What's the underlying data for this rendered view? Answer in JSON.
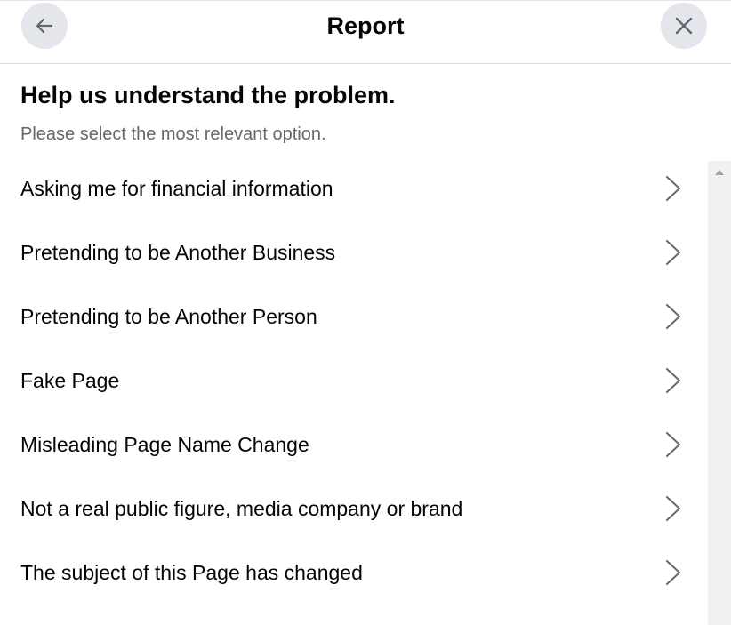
{
  "header": {
    "title": "Report",
    "back_icon": "arrow-left-icon",
    "close_icon": "close-icon"
  },
  "main": {
    "heading": "Help us understand the problem.",
    "subheading": "Please select the most relevant option.",
    "options": [
      {
        "label": "Asking me for financial information",
        "icon": "chevron-right-icon"
      },
      {
        "label": "Pretending to be Another Business",
        "icon": "chevron-right-icon"
      },
      {
        "label": "Pretending to be Another Person",
        "icon": "chevron-right-icon"
      },
      {
        "label": "Fake Page",
        "icon": "chevron-right-icon"
      },
      {
        "label": "Misleading Page Name Change",
        "icon": "chevron-right-icon"
      },
      {
        "label": "Not a real public figure, media company or brand",
        "icon": "chevron-right-icon"
      },
      {
        "label": "The subject of this Page has changed",
        "icon": "chevron-right-icon"
      }
    ]
  },
  "colors": {
    "button_bg": "#e4e6eb",
    "primary_text": "#050505",
    "secondary_text": "#65676b",
    "divider": "#dadde1",
    "scrollbar_track": "#f1f1f1"
  }
}
